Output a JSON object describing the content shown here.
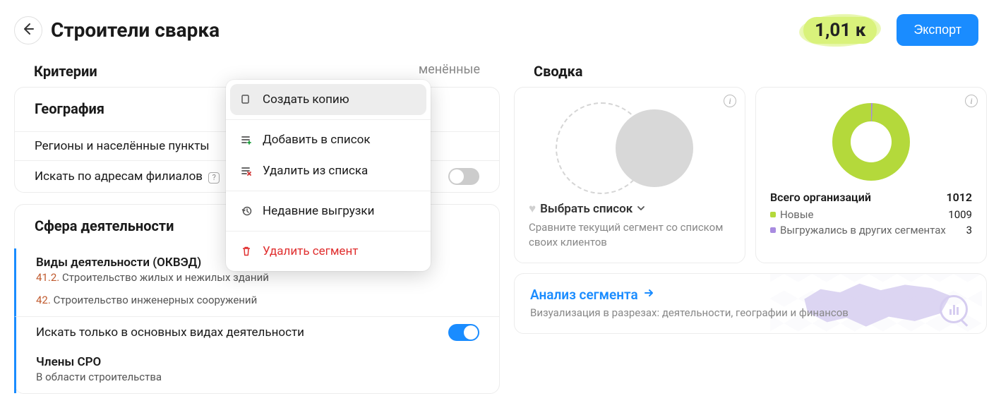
{
  "header": {
    "title": "Строители сварка",
    "count": "1,01 к",
    "export": "Экспорт"
  },
  "criteria": {
    "title": "Критерии",
    "tab_changed": "менённые",
    "geography": {
      "heading": "География",
      "regions_label": "Регионы и населённые пункты",
      "branches_label": "Искать по адресам филиалов"
    },
    "activity": {
      "heading": "Сфера деятельности",
      "okved_label": "Виды деятельности (ОКВЭД)",
      "okved_items": [
        {
          "code": "41.2.",
          "text": "Строительство жилых и нежилых зданий"
        },
        {
          "code": "42.",
          "text": "Строительство инженерных сооружений"
        }
      ],
      "main_only_label": "Искать только в основных видах деятельности",
      "sro_label": "Члены СРО",
      "sro_sub": "В области строительства"
    }
  },
  "menu": {
    "copy": "Создать копию",
    "add_list": "Добавить в список",
    "remove_list": "Удалить из списка",
    "recent": "Недавние выгрузки",
    "delete": "Удалить сегмент"
  },
  "summary": {
    "title": "Сводка",
    "select_list": "Выбрать список",
    "compare_hint": "Сравните текущий сегмент со списком своих клиентов",
    "total_label": "Всего организаций",
    "total_value": "1012",
    "legend": [
      {
        "color": "#b4d93b",
        "label": "Новые",
        "value": "1009"
      },
      {
        "color": "#a88be0",
        "label": "Выгружались в других сегментах",
        "value": "3"
      }
    ],
    "analysis_title": "Анализ сегмента",
    "analysis_sub": "Визуализация в разрезах: деятельности, географии и финансов"
  },
  "chart_data": {
    "type": "pie",
    "title": "Всего организаций",
    "total": 1012,
    "series": [
      {
        "name": "Новые",
        "value": 1009,
        "color": "#b4d93b"
      },
      {
        "name": "Выгружались в других сегментах",
        "value": 3,
        "color": "#a88be0"
      }
    ]
  }
}
